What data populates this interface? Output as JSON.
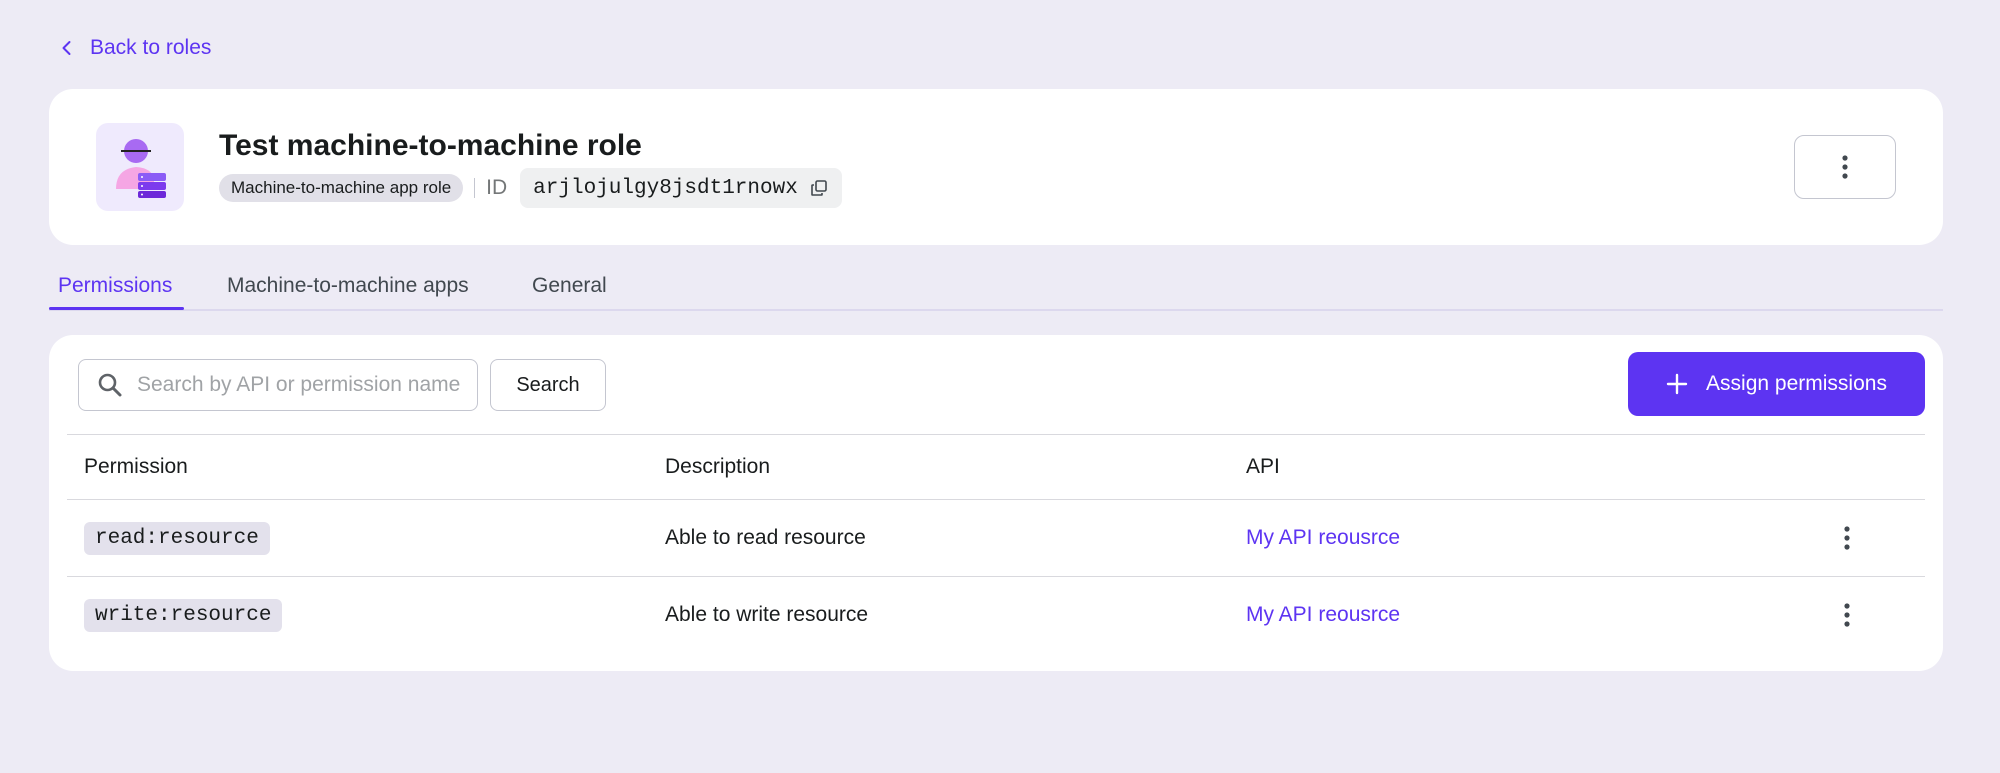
{
  "nav": {
    "back_label": "Back to roles"
  },
  "role": {
    "title": "Test machine-to-machine role",
    "type_badge": "Machine-to-machine app role",
    "id_label": "ID",
    "id_value": "arjlojulgy8jsdt1rnowx"
  },
  "tabs": [
    {
      "label": "Permissions",
      "active": true
    },
    {
      "label": "Machine-to-machine apps",
      "active": false
    },
    {
      "label": "General",
      "active": false
    }
  ],
  "toolbar": {
    "search_placeholder": "Search by API or permission name",
    "search_button": "Search",
    "assign_button": "Assign permissions"
  },
  "table": {
    "columns": [
      "Permission",
      "Description",
      "API"
    ],
    "rows": [
      {
        "permission": "read:resource",
        "description": "Able to read resource",
        "api": "My API reousrce"
      },
      {
        "permission": "write:resource",
        "description": "Able to write resource",
        "api": "My API reousrce"
      }
    ]
  },
  "colors": {
    "accent": "#5d34f2",
    "background": "#edebf5",
    "card": "#ffffff"
  }
}
